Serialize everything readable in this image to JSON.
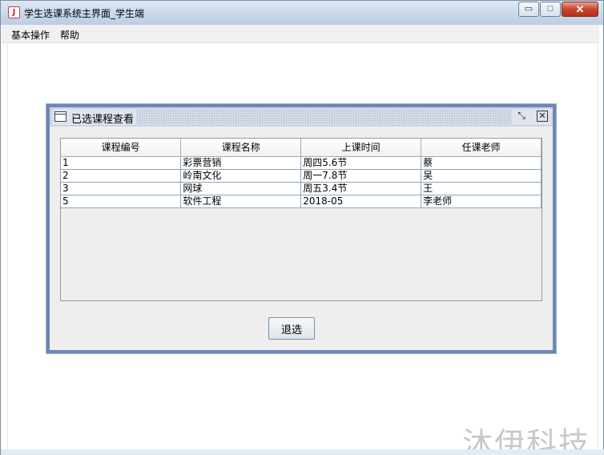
{
  "window": {
    "title": "学生选课系统主界面_学生端",
    "app_icon": "java-icon",
    "controls": {
      "minimize": "▭",
      "maximize": "□",
      "close": "✕"
    }
  },
  "menubar": {
    "items": [
      {
        "label": "基本操作"
      },
      {
        "label": "帮助"
      }
    ]
  },
  "internal_frame": {
    "title": "已选课程查看",
    "icons": {
      "frame": "window-icon",
      "restore": "restore-icon",
      "close": "close-icon"
    },
    "restore_glyph": "⤡",
    "close_glyph": "✕",
    "table": {
      "columns": [
        "课程编号",
        "课程名称",
        "上课时间",
        "任课老师"
      ],
      "rows": [
        [
          "1",
          "彩票营销",
          "周四5.6节",
          "蔡"
        ],
        [
          "2",
          "岭南文化",
          "周一7.8节",
          "吴"
        ],
        [
          "3",
          "网球",
          "周五3.4节",
          "王"
        ],
        [
          "5",
          "软件工程",
          "2018-05",
          "李老师"
        ]
      ]
    },
    "quit_button": "退选"
  },
  "watermark": "沐伊科技",
  "colors": {
    "frame_border": "#6d86b4",
    "close_button": "#c8452e",
    "titlebar": "#c9d8ea"
  }
}
